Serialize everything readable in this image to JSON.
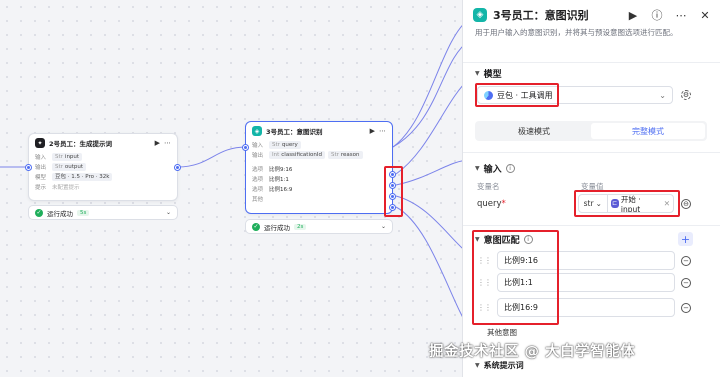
{
  "node_prev": {
    "title": "2号员工：生成提示词",
    "rows": [
      {
        "key": "输入",
        "tag_prefix": "Str",
        "tag": "input"
      },
      {
        "key": "输出",
        "tag_prefix": "Str",
        "tag": "output"
      },
      {
        "key": "模型",
        "tag": "豆包 · 1.5 · Pro · 32k"
      },
      {
        "key": "提示",
        "tag": "未配置提示"
      }
    ],
    "status_label": "运行成功",
    "status_time": "5s"
  },
  "node_intent": {
    "title": "3号员工：意图识别",
    "rows": [
      {
        "key": "输入",
        "tag_prefix": "Str",
        "tag": "query"
      },
      {
        "key": "输出",
        "tag_prefix": "Int",
        "tag": "classificationId",
        "tag2_prefix": "Str",
        "tag2": "reason"
      }
    ],
    "options": [
      {
        "key": "选项",
        "value": "比例9:16"
      },
      {
        "key": "选项",
        "value": "比例1:1"
      },
      {
        "key": "选项",
        "value": "比例16:9"
      },
      {
        "key": "其他",
        "value": ""
      }
    ],
    "status_label": "运行成功",
    "status_time": "2s"
  },
  "panel": {
    "title": "3号员工：意图识别",
    "description": "用于用户输入的意图识别，并将其与预设意图选项进行匹配。",
    "model_section": "模型",
    "model_value": "豆包 · 工具调用",
    "modes": [
      "极速模式",
      "完整模式"
    ],
    "active_mode": "完整模式",
    "input_section": "输入",
    "col_var_name": "变量名",
    "col_var_value": "变量值",
    "query_label": "query",
    "var_type": "str",
    "var_ref": "开始 · input",
    "intent_section": "意图匹配",
    "intents": [
      "比例9:16",
      "比例1:1",
      "比例16:9"
    ],
    "other_intent": "其他意图",
    "system_prompt_section": "系统提示词"
  },
  "watermark": "掘金技术社区 @ 大白学智能体",
  "colors": {
    "accent": "#4e6ef2",
    "teal": "#13b5a8",
    "success": "#1fae5b",
    "highlight": "#e5202b"
  }
}
